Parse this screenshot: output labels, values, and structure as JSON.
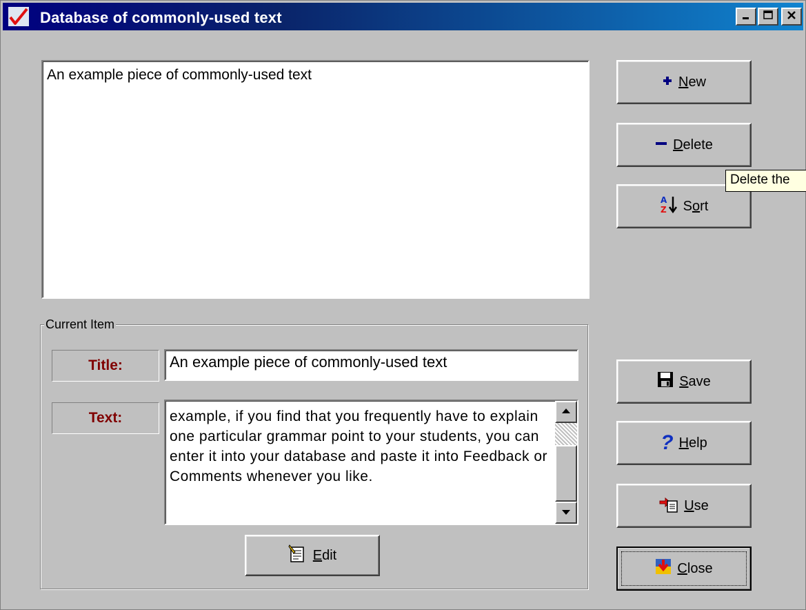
{
  "window": {
    "title": "Database of commonly-used text",
    "icon": "checkmark-icon",
    "controls": [
      "minimize-icon",
      "maximize-icon",
      "close-icon"
    ]
  },
  "list": {
    "items": [
      "An example piece of commonly-used text"
    ]
  },
  "current_item": {
    "group_label": "Current Item",
    "title_label": "Title:",
    "title_value": "An example piece of commonly-used text",
    "text_label": "Text:",
    "text_value": "example, if you find that you frequently have to explain one particular grammar point to your students, you can enter it into your database and paste it into Feedback or Comments whenever you like.",
    "edit_button": {
      "mnemonic": "E",
      "rest": "dit",
      "icon": "edit-notepad-icon"
    }
  },
  "buttons": {
    "new": {
      "mnemonic": "N",
      "rest": "ew",
      "icon": "plus-icon"
    },
    "delete": {
      "mnemonic": "D",
      "rest": "elete",
      "icon": "minus-icon"
    },
    "sort": {
      "pre": "S",
      "mnemonic": "o",
      "rest": "rt",
      "icon": "sort-az-icon"
    },
    "save": {
      "mnemonic": "S",
      "rest": "ave",
      "icon": "floppy-disk-icon"
    },
    "help": {
      "mnemonic": "H",
      "rest": "elp",
      "icon": "question-mark-icon"
    },
    "use": {
      "mnemonic": "U",
      "rest": "se",
      "icon": "paste-arrow-icon"
    },
    "close": {
      "mnemonic": "C",
      "rest": "lose",
      "icon": "exit-door-icon"
    }
  },
  "tooltip": {
    "text": "Delete the"
  },
  "colors": {
    "label_text": "#800000",
    "titlebar_start": "#000080",
    "titlebar_end": "#1084d0",
    "tooltip_bg": "#ffffe1"
  }
}
